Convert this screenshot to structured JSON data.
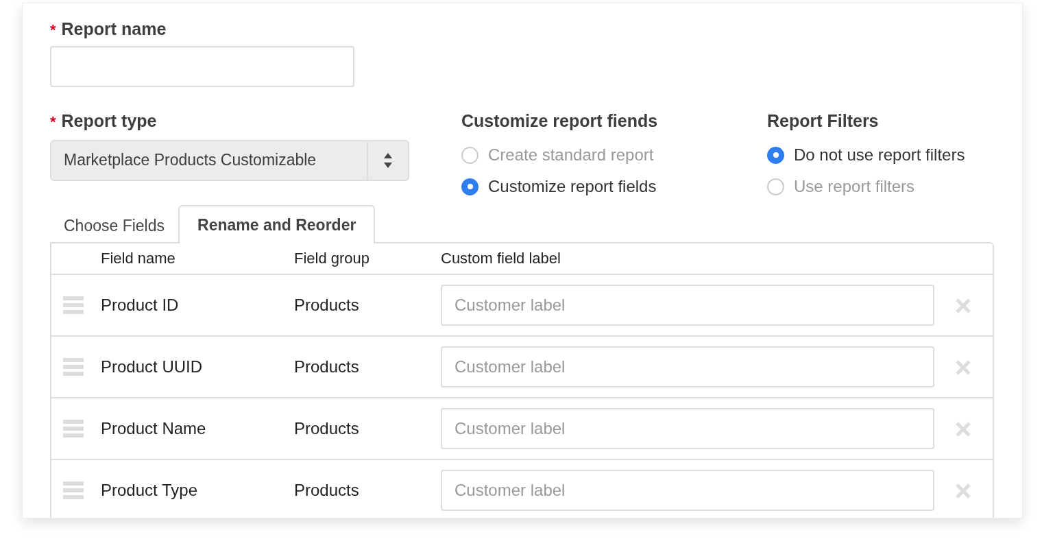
{
  "report_name": {
    "required_mark": "*",
    "label": "Report name"
  },
  "report_type": {
    "required_mark": "*",
    "label": "Report type",
    "value": "Marketplace Products Customizable"
  },
  "customize_fields": {
    "title": "Customize report fiends",
    "options": [
      {
        "label": "Create standard report",
        "selected": false
      },
      {
        "label": "Customize report fields",
        "selected": true
      }
    ]
  },
  "report_filters": {
    "title": "Report Filters",
    "options": [
      {
        "label": "Do not use report filters",
        "selected": true
      },
      {
        "label": "Use report filters",
        "selected": false
      }
    ]
  },
  "tabs": [
    {
      "label": "Choose Fields",
      "selected": false
    },
    {
      "label": "Rename and Reorder",
      "selected": true
    }
  ],
  "table": {
    "columns": [
      "Field name",
      "Field group",
      "Custom field label"
    ],
    "rows": [
      {
        "field_name": "Product ID",
        "field_group": "Products",
        "placeholder": "Customer label"
      },
      {
        "field_name": "Product UUID",
        "field_group": "Products",
        "placeholder": "Customer label"
      },
      {
        "field_name": "Product Name",
        "field_group": "Products",
        "placeholder": "Customer label"
      },
      {
        "field_name": "Product Type",
        "field_group": "Products",
        "placeholder": "Customer label"
      }
    ]
  }
}
